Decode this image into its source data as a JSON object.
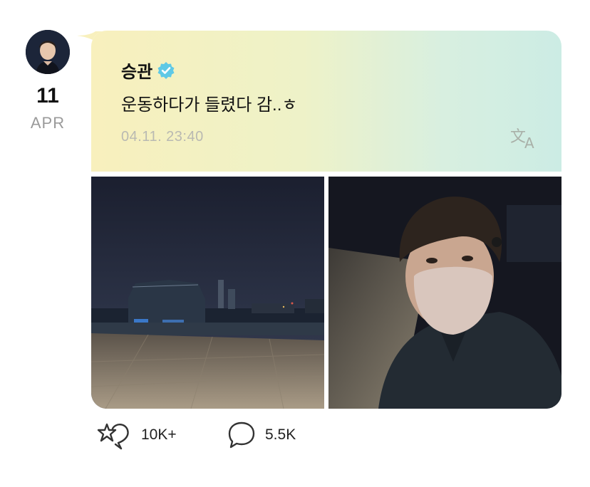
{
  "date": {
    "day": "11",
    "month": "APR"
  },
  "post": {
    "author": "승관",
    "text": "운동하다가 들렸다 감..ㅎ",
    "timestamp": "04.11. 23:40",
    "verified": true
  },
  "photos": [
    {
      "description": "night-river-park"
    },
    {
      "description": "masked-selfie"
    }
  ],
  "actions": {
    "likes": "10K+",
    "comments": "5.5K"
  },
  "icons": {
    "verified": "verified-badge-icon",
    "translate": "translate-icon",
    "like": "like-icon",
    "comment": "comment-icon"
  },
  "colors": {
    "verified": "#5fc9e6",
    "gradient_start": "#f8f0bd",
    "gradient_end": "#ccece4"
  }
}
